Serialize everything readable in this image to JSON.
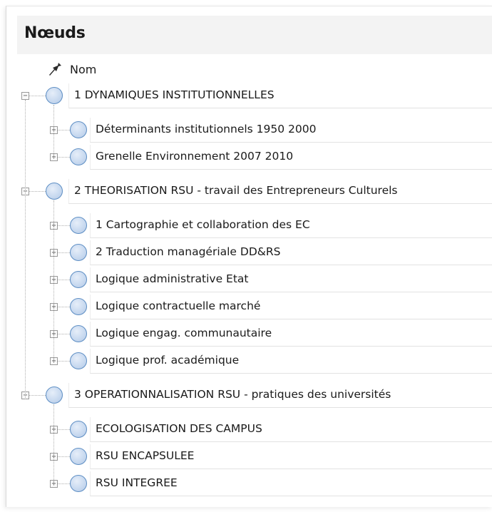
{
  "panel": {
    "title": "Nœuds"
  },
  "columns": {
    "name_header": "Nom"
  },
  "tree": [
    {
      "label": "1 DYNAMIQUES INSTITUTIONNELLES",
      "expanded": true,
      "children": [
        {
          "label": "Déterminants institutionnels 1950 2000",
          "expanded": false
        },
        {
          "label": "Grenelle Environnement 2007 2010",
          "expanded": false
        }
      ]
    },
    {
      "label": "2 THEORISATION RSU - travail des Entrepreneurs Culturels",
      "expanded": true,
      "children": [
        {
          "label": "1 Cartographie et collaboration des EC",
          "expanded": false
        },
        {
          "label": "2 Traduction managériale DD&RS",
          "expanded": false
        },
        {
          "label": "Logique administrative Etat",
          "expanded": false
        },
        {
          "label": "Logique contractuelle marché",
          "expanded": false
        },
        {
          "label": "Logique engag. communautaire",
          "expanded": false
        },
        {
          "label": "Logique prof. académique",
          "expanded": false
        }
      ]
    },
    {
      "label": "3 OPERATIONNALISATION RSU - pratiques des universités",
      "expanded": true,
      "children": [
        {
          "label": "ECOLOGISATION DES CAMPUS",
          "expanded": false
        },
        {
          "label": "RSU ENCAPSULEE",
          "expanded": false
        },
        {
          "label": "RSU INTEGREE",
          "expanded": false
        }
      ]
    }
  ],
  "colors": {
    "node_border": "#5d8ec4",
    "node_fill": "#c9daf0",
    "header_bg": "#f3f3f3"
  },
  "icons": {
    "column_header": "pin-icon",
    "node": "node-circle-icon",
    "expanded": "collapse-minus-icon",
    "collapsed": "expand-plus-icon"
  }
}
